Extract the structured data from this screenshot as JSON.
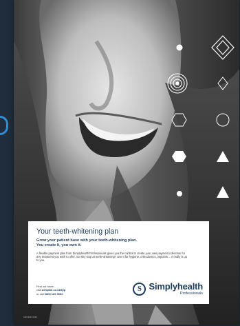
{
  "card": {
    "title": "Your teeth-whitening plan",
    "subtitle_line1": "Grow your patient base with your teeth-whitening plan.",
    "subtitle_line2": "You create it, you own it.",
    "body": "A flexible payment plan from Simplyhealth Professionals gives you the control to create your own payment collection for any treatment you wish to offer. So why stop at teeth-whitening? Use it for hygiene, orthodontics, implants… it really is up to you.",
    "find_out": "Find out more:",
    "visit_prefix": "visit ",
    "url": "denplan.co.uk/fpp",
    "call_prefix": "or call ",
    "phone": "0800 169 9962"
  },
  "brand": {
    "name": "Simplyhealth",
    "sub": "Professionals",
    "mark_glyph": "S"
  },
  "footnote": "SHPL2843 10/19",
  "colors": {
    "brand_navy": "#1d3c5c",
    "page_bg": "#1f2d3d",
    "accent_blue": "#2f8fd6",
    "shape_white": "#ffffff"
  },
  "decorations": [
    "circle-dot-icon",
    "concentric-circles-icon",
    "diamond-outline-icon",
    "hexagon-icon",
    "triangle-icon"
  ]
}
